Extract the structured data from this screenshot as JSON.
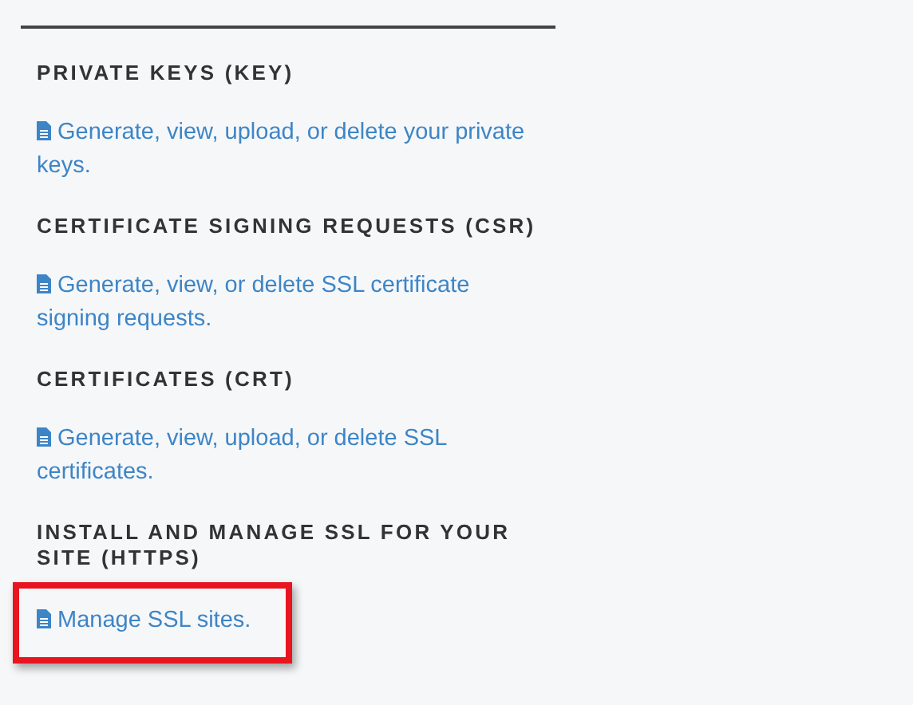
{
  "sections": [
    {
      "heading": "PRIVATE KEYS (KEY)",
      "link": "Generate, view, upload, or delete your private keys.",
      "highlighted": false
    },
    {
      "heading": "CERTIFICATE SIGNING REQUESTS (CSR)",
      "link": "Generate, view, or delete SSL certificate signing requests.",
      "highlighted": false
    },
    {
      "heading": "CERTIFICATES (CRT)",
      "link": "Generate, view, upload, or delete SSL certificates.",
      "highlighted": false
    },
    {
      "heading": "INSTALL AND MANAGE SSL FOR YOUR SITE (HTTPS)",
      "link": "Manage SSL sites.",
      "highlighted": true
    }
  ]
}
